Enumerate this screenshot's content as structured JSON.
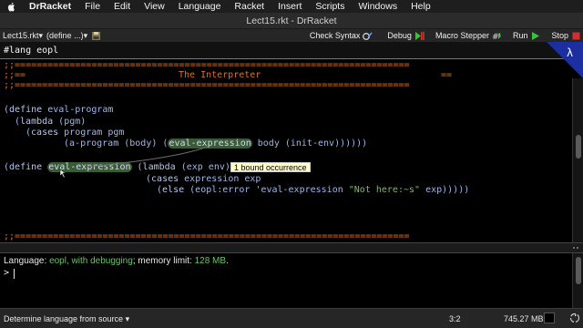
{
  "menubar": {
    "app_name": "DrRacket",
    "items": [
      "File",
      "Edit",
      "View",
      "Language",
      "Racket",
      "Insert",
      "Scripts",
      "Windows",
      "Help"
    ]
  },
  "window": {
    "title": "Lect15.rkt - DrRacket"
  },
  "toolbar": {
    "file_selector": "Lect15.rkt▾",
    "define_selector": "(define ...)▾",
    "check_syntax": "Check Syntax",
    "debug": "Debug",
    "macro_stepper": "Macro Stepper",
    "run": "Run",
    "stop": "Stop"
  },
  "editor": {
    "lang_line": "#lang eopl",
    "comment_rule_1": ";;========================================================================",
    "comment_title_pre": ";;==",
    "comment_title": "The Interpreter",
    "comment_title_post": "==",
    "comment_rule_2": ";;========================================================================",
    "comment_rule_3": ";;========================================================================",
    "tooltip": "1 bound occurrence",
    "code": {
      "l1_define": "define",
      "l1_name": "eval-program",
      "l2_lambda": "lambda",
      "l2_args": "pgm",
      "l3_cases": "cases",
      "l3_rest": " program pgm",
      "l4_a": "a-program",
      "l4_body": "body",
      "l4_call": "eval-expression",
      "l4_rest": " body ",
      "l4_env": "init-env",
      "l5_define": "define",
      "l5_name": "eval-expression",
      "l5_lambda": "lambda",
      "l5_args": "exp env",
      "l6_cases": "cases",
      "l6_rest": " expression exp",
      "l7_else": "else",
      "l7_err": "eopl:error",
      "l7_sym": " 'eval-expression ",
      "l7_str": "\"Not here:~s\"",
      "l7_exp": " exp"
    }
  },
  "interactions": {
    "lang_prefix": "Language: ",
    "lang_name": "eopl, with debugging",
    "mem_prefix": "; memory limit: ",
    "mem_limit": "128 MB",
    "mem_suffix": ".",
    "prompt": ">"
  },
  "statusbar": {
    "language_selector": "Determine language from source ▾",
    "position": "3:2",
    "memory": "745.27 MB"
  },
  "colors": {
    "comment": "#e07020",
    "code": "#9cb7ec",
    "string": "#84b865",
    "highlight": "#3b5b36",
    "run_green": "#3fbf3f",
    "stop_red": "#d42d2d"
  }
}
